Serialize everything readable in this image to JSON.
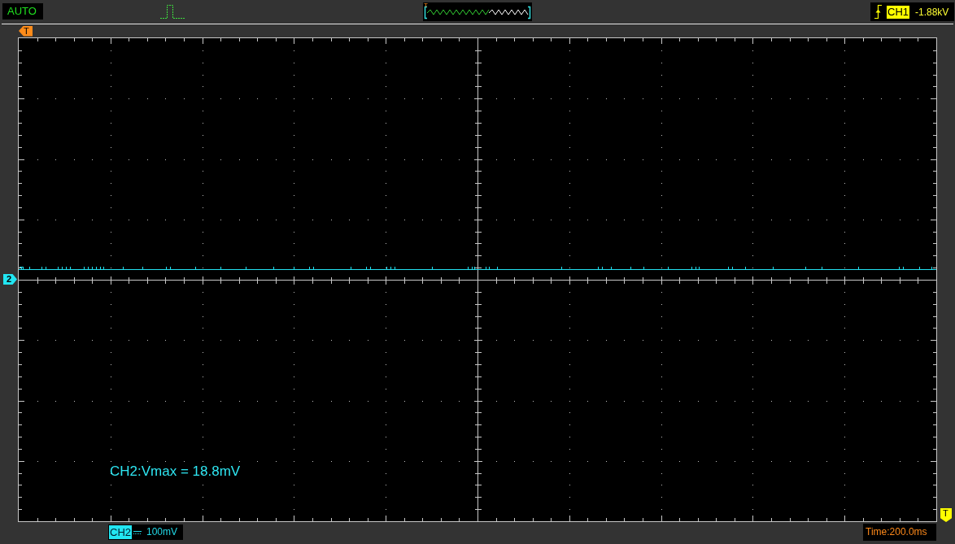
{
  "top_bar": {
    "mode": "AUTO",
    "overview": {
      "trigger_marker": "T"
    },
    "trigger": {
      "source": "CH1",
      "value": "-1.88kV"
    }
  },
  "plot": {
    "trigger_position_marker": "T",
    "channel_marker": "2",
    "trigger_level_marker": "T",
    "measurement": "CH2:Vmax = 18.8mV"
  },
  "bottom_bar": {
    "channel": "CH2",
    "scale": "100mV",
    "timebase": "Time:200.0ms"
  }
}
